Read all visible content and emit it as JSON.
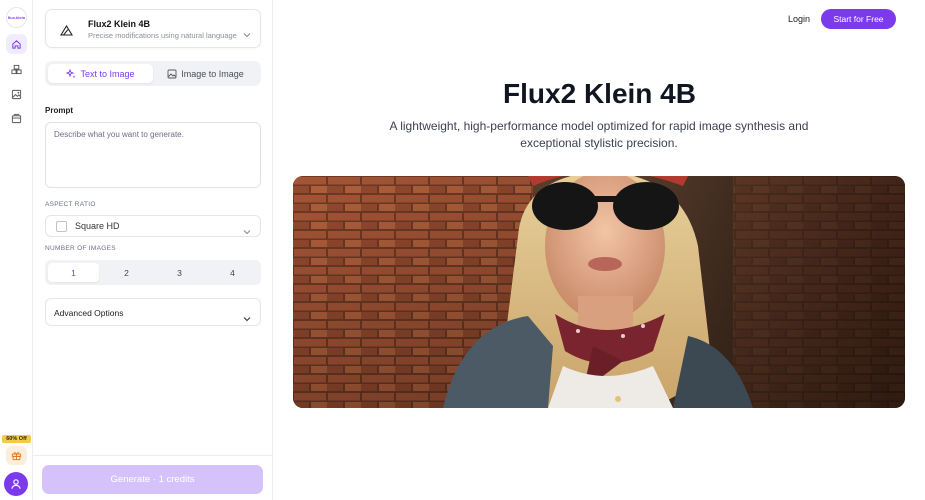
{
  "rail": {
    "logo_text": "flux.klein",
    "items": [
      "home-icon",
      "layers-icon",
      "image-icon",
      "gallery-icon"
    ],
    "promo": "60% Off"
  },
  "model": {
    "name": "Flux2 Klein 4B",
    "description": "Precise modifications using natural language"
  },
  "tabs": [
    {
      "label": "Text to Image",
      "active": true
    },
    {
      "label": "Image to Image",
      "active": false
    }
  ],
  "prompt": {
    "label": "Prompt",
    "placeholder": "Describe what you want to generate."
  },
  "aspect_ratio": {
    "label": "ASPECT RATIO",
    "value": "Square HD"
  },
  "num_images": {
    "label": "NUMBER OF IMAGES",
    "options": [
      "1",
      "2",
      "3",
      "4"
    ],
    "selected": "1"
  },
  "advanced": {
    "label": "Advanced Options"
  },
  "generate": {
    "label": "Generate · 1 credits"
  },
  "header": {
    "login": "Login",
    "start": "Start for Free"
  },
  "hero": {
    "title": "Flux2 Klein 4B",
    "subtitle": "A lightweight, high-performance model optimized for rapid image synthesis and exceptional stylistic precision."
  },
  "colors": {
    "accent": "#7c3aed",
    "accent_light": "#d6c2fa",
    "promo": "#f5c84a"
  }
}
